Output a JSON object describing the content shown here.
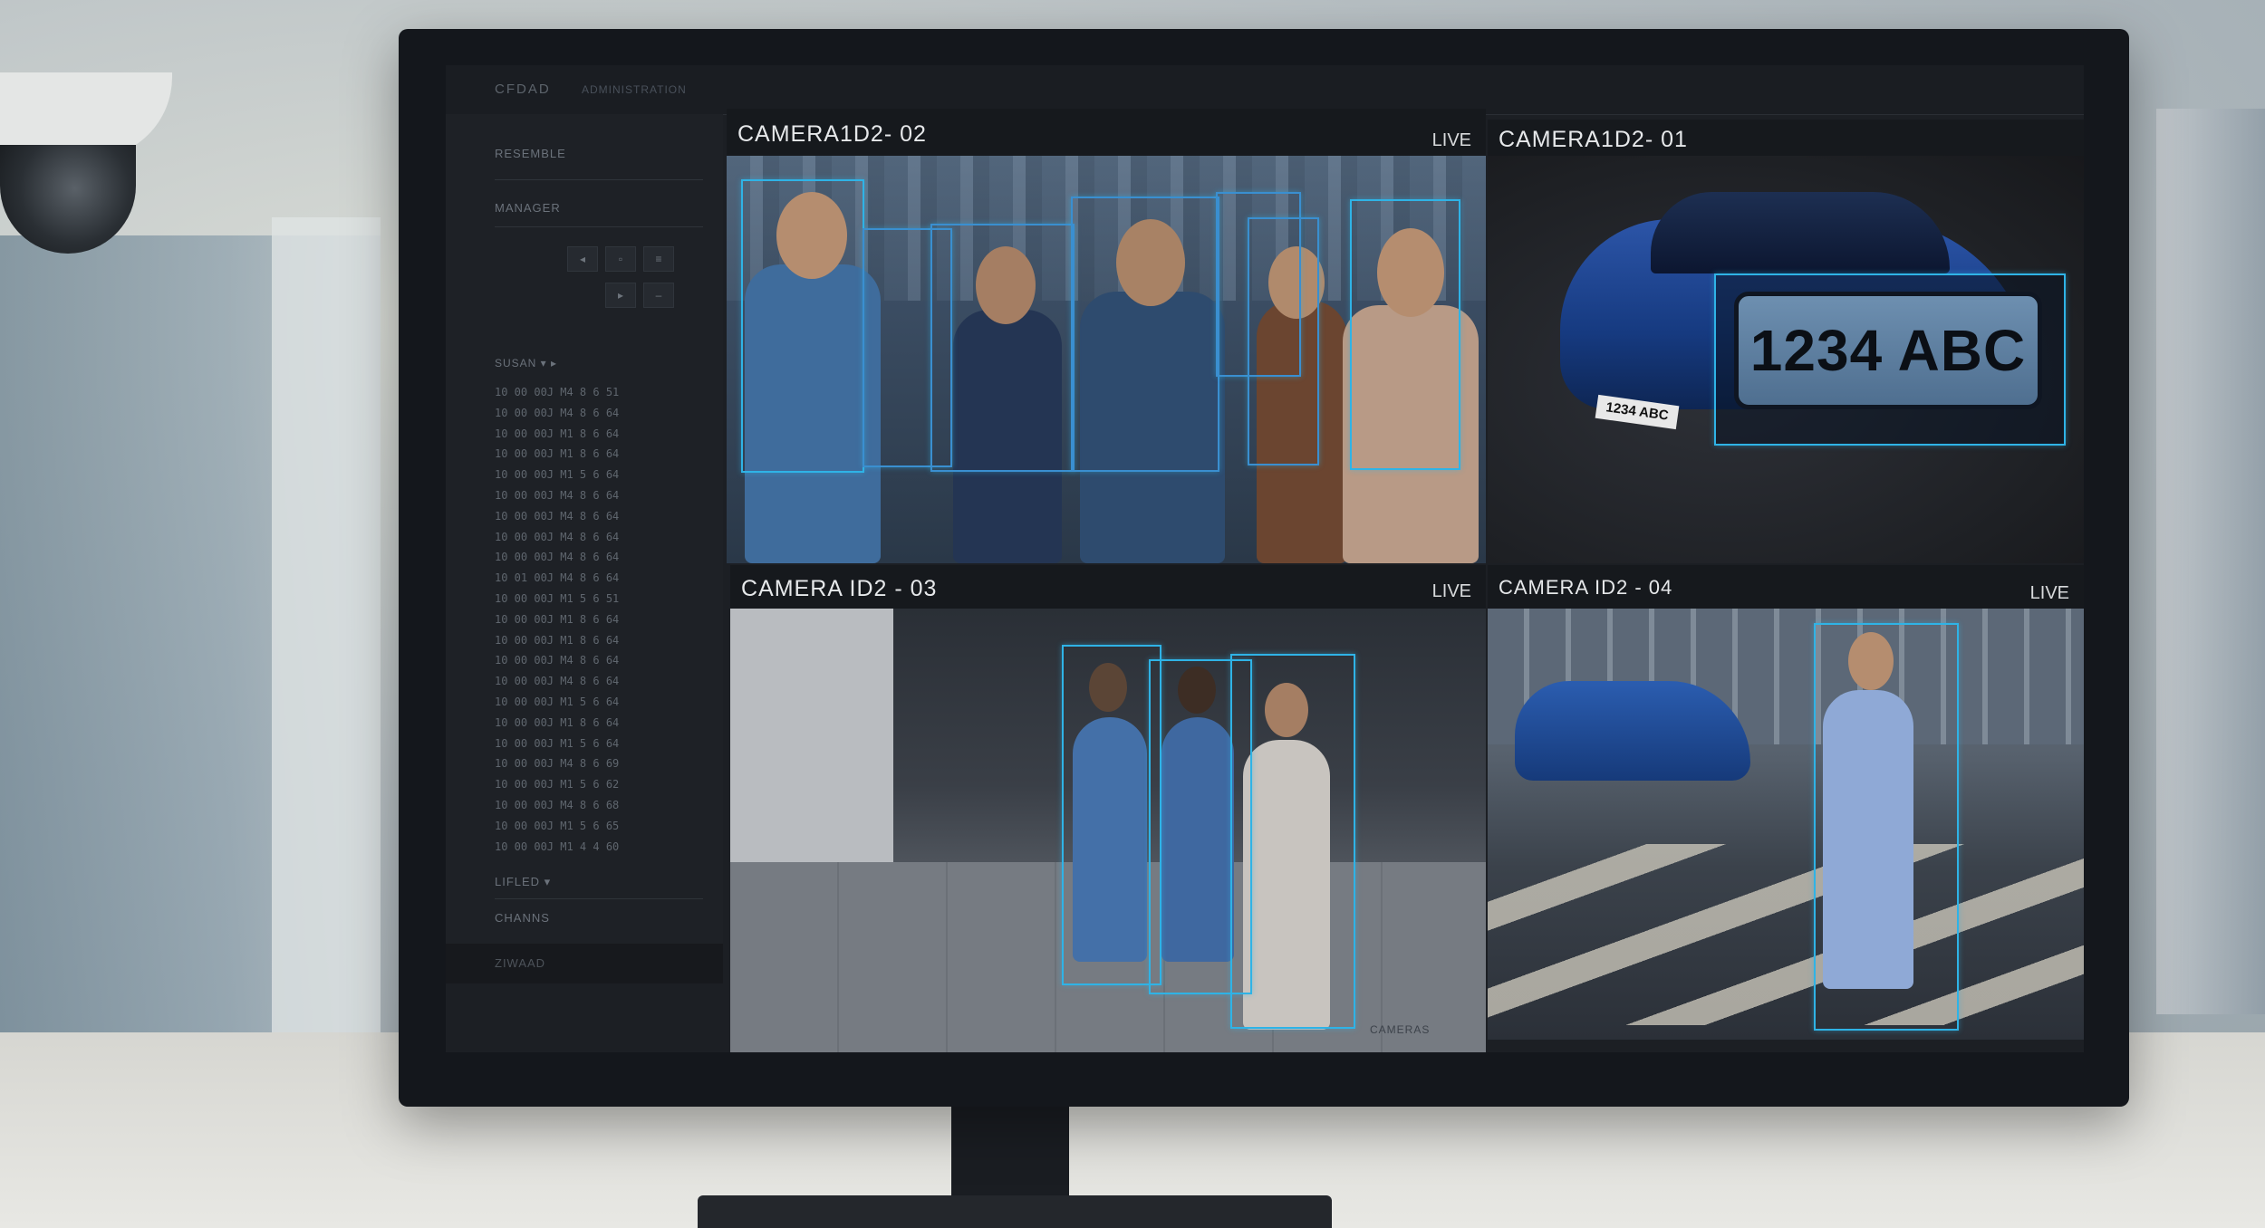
{
  "app": {
    "title": "CFDAD",
    "tab": "ADMINISTRATION"
  },
  "sidebar": {
    "section1": "RESEMBLE",
    "section2": "MANAGER",
    "controls": [
      "◂",
      "▫",
      "≡",
      "▸",
      "–"
    ],
    "list_header": "SUSAN ▾ ▸",
    "rows": [
      "10 00 00J M4 8 6 51",
      "10 00 00J M4 8 6 64",
      "10 00 00J M1 8 6 64",
      "10 00 00J M1 8 6 64",
      "10 00 00J M1 5 6 64",
      "10 00 00J M4 8 6 64",
      "10 00 00J M4 8 6 64",
      "10 00 00J M4 8 6 64",
      "10 00 00J M4 8 6 64",
      "10 01 00J M4 8 6 64",
      "10 00 00J M1 5 6 51",
      "10 00 00J M1 8 6 64",
      "10 00 00J M1 8 6 64",
      "10 00 00J M4 8 6 64",
      "10 00 00J M4 8 6 64",
      "10 00 00J M1 5 6 64",
      "10 00 00J M1 8 6 64",
      "10 00 00J M1 5 6 64",
      "10 00 00J M4 8 6 69",
      "10 00 00J M1 5 6 62",
      "10 00 00J M4 8 6 68",
      "10 00 00J M1 5 6 65",
      "10 00 00J M1 4 4 60"
    ],
    "filter_label": "LIFLED ▾",
    "channels_label": "CHANNS",
    "footer_label": "ZIWAAD"
  },
  "footer_caption": "CAMERAS",
  "feeds": [
    {
      "id": "feed-02",
      "title": "CAMERA1D2- 02",
      "live": "LIVE"
    },
    {
      "id": "feed-01",
      "title": "CAMERA1D2- 01",
      "live": "",
      "plate_small": "1234 ABC",
      "plate_zoom": "1234 ABC"
    },
    {
      "id": "feed-03",
      "title": "CAMERA ID2 - 03",
      "live": "LIVE"
    },
    {
      "id": "feed-04",
      "title": "CAMERA ID2 - 04",
      "live": "LIVE"
    }
  ],
  "colors": {
    "detection": "#2fb3e6",
    "screen_bg": "#1c1f24",
    "bezel": "#14171c"
  }
}
